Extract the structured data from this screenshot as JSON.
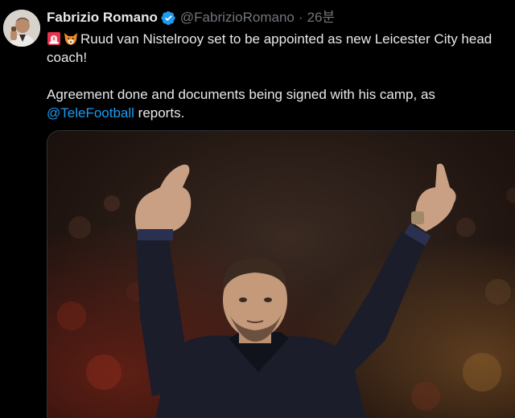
{
  "author": {
    "name": "Fabrizio Romano",
    "handle": "@FabrizioRomano",
    "separator": "·",
    "time": "26분",
    "verified_color": "#1d9bf0",
    "avatar_icon": "profile-photo"
  },
  "tweet": {
    "emoji": [
      "siren-emoji",
      "fox-emoji"
    ],
    "line1": "Ruud van Nistelrooy set to be appointed as new Leicester City head coach!",
    "line2_before": "Agreement done and documents being signed with his camp, as ",
    "mention": "@TeleFootball",
    "line2_after": " reports."
  },
  "colors": {
    "background": "#000000",
    "text": "#e7e9ea",
    "muted": "#71767b",
    "link": "#1d9bf0"
  }
}
